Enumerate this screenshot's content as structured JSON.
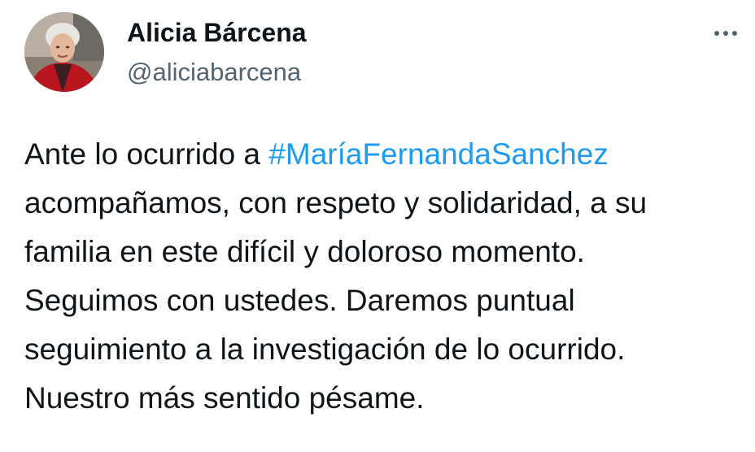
{
  "author": {
    "display_name": "Alicia Bárcena",
    "handle": "@aliciabarcena",
    "avatar_icon": "profile-photo"
  },
  "menu": {
    "icon": "more-horizontal-icon"
  },
  "tweet": {
    "line1_prefix": "Ante lo ocurrido a ",
    "hashtag": "#MaríaFernandaSanchez",
    "line2": "acompañamos, con respeto y solidaridad, a su",
    "line3": "familia en este difícil y doloroso momento.",
    "line4": "Seguimos con ustedes. Daremos puntual",
    "line5": "seguimiento a la investigación de lo ocurrido.",
    "line6": "Nuestro más sentido pésame."
  },
  "colors": {
    "text": "#0f1419",
    "secondary": "#536471",
    "link": "#1d9bf0",
    "background": "#ffffff"
  }
}
